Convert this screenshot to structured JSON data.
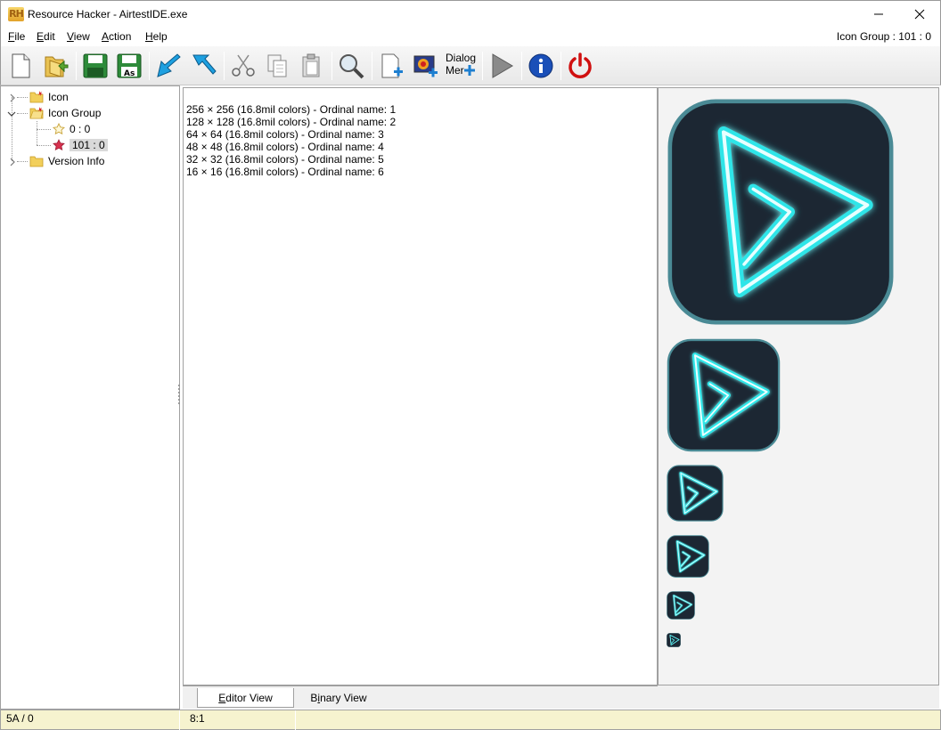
{
  "window": {
    "title": "Resource Hacker - AirtestIDE.exe",
    "logo_text": "RH"
  },
  "menu": {
    "items": [
      {
        "accel": "F",
        "rest": "ile"
      },
      {
        "accel": "E",
        "rest": "dit"
      },
      {
        "accel": "V",
        "rest": "iew"
      },
      {
        "accel": "A",
        "rest": "ction"
      },
      {
        "accel": "H",
        "rest": "elp"
      }
    ],
    "status": "Icon Group : 101 : 0"
  },
  "toolbar": {
    "dialog_label_line1": "Dialog",
    "dialog_label_line2": "Mer"
  },
  "tree": {
    "items": [
      {
        "label": "Icon"
      },
      {
        "label": "Icon Group"
      },
      {
        "label": "0 : 0"
      },
      {
        "label": "101 : 0"
      },
      {
        "label": "Version Info"
      }
    ]
  },
  "editor": {
    "lines": [
      "256 × 256 (16.8mil colors) - Ordinal name: 1",
      "128 × 128 (16.8mil colors) - Ordinal name: 2",
      "64 × 64 (16.8mil colors) - Ordinal name: 3",
      "48 × 48 (16.8mil colors) - Ordinal name: 4",
      "32 × 32 (16.8mil colors) - Ordinal name: 5",
      "16 × 16 (16.8mil colors) - Ordinal name: 6"
    ]
  },
  "tabs": [
    {
      "accel": "E",
      "rest": "ditor View",
      "pre": ""
    },
    {
      "accel": "i",
      "rest": "nary View",
      "pre": "B"
    }
  ],
  "status": {
    "left": "5A / 0",
    "right": "8:1"
  },
  "colors": {
    "icon_bg": "#1c2733",
    "icon_border": "#4a8a95",
    "neon": "#2fe5e8",
    "status_bg": "#f6f3cf"
  }
}
